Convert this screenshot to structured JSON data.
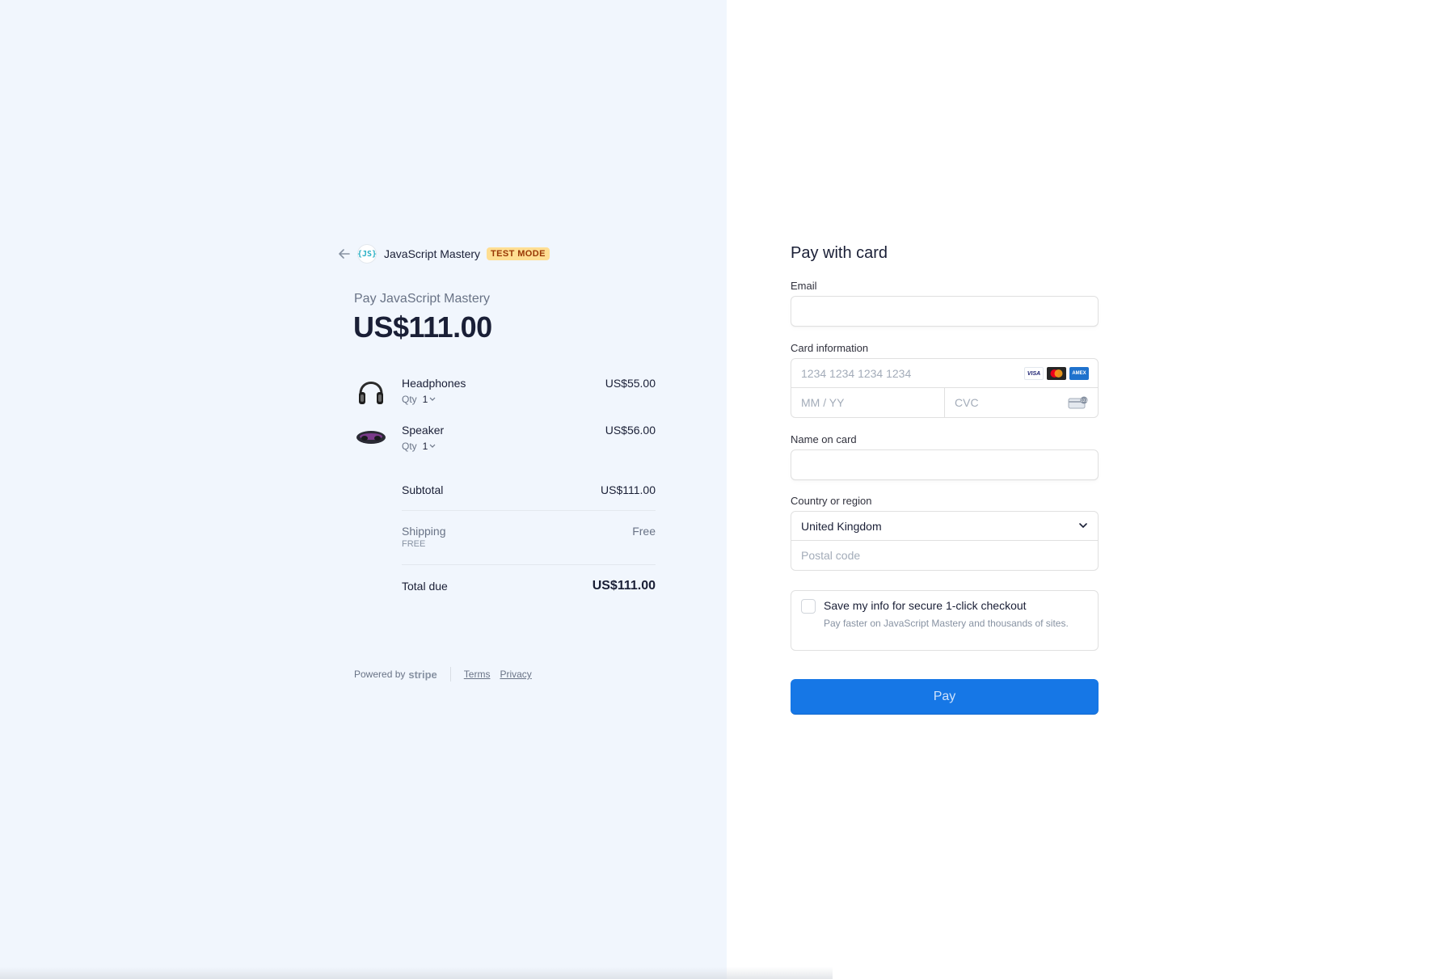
{
  "header": {
    "merchant_logo_text": "{JS}",
    "merchant_name": "JavaScript Mastery",
    "test_mode_label": "TEST MODE"
  },
  "summary": {
    "pay_label": "Pay JavaScript Mastery",
    "amount": "US$111.00"
  },
  "items": [
    {
      "name": "Headphones",
      "qty_label": "Qty",
      "qty": "1",
      "price": "US$55.00",
      "image_icon": "headphones-icon"
    },
    {
      "name": "Speaker",
      "qty_label": "Qty",
      "qty": "1",
      "price": "US$56.00",
      "image_icon": "speaker-icon"
    }
  ],
  "totals": {
    "subtotal_label": "Subtotal",
    "subtotal_value": "US$111.00",
    "shipping_label": "Shipping",
    "shipping_sub": "FREE",
    "shipping_value": "Free",
    "total_label": "Total due",
    "total_value": "US$111.00"
  },
  "footer": {
    "powered_by": "Powered by",
    "stripe": "stripe",
    "terms": "Terms",
    "privacy": "Privacy"
  },
  "form": {
    "title": "Pay with card",
    "email_label": "Email",
    "email_value": "",
    "card_label": "Card information",
    "card_number_placeholder": "1234 1234 1234 1234",
    "expiry_placeholder": "MM / YY",
    "cvc_placeholder": "CVC",
    "card_brands": {
      "visa": "VISA",
      "mastercard": "mastercard-icon",
      "amex": "AMEX"
    },
    "name_label": "Name on card",
    "name_value": "",
    "country_label": "Country or region",
    "country_value": "United Kingdom",
    "postal_placeholder": "Postal code",
    "save_title": "Save my info for secure 1-click checkout",
    "save_desc": "Pay faster on JavaScript Mastery and thousands of sites.",
    "pay_button": "Pay"
  },
  "colors": {
    "left_bg": "#f1f6fd",
    "pay_button": "#1677e6",
    "test_badge_bg": "#ffde92",
    "test_badge_text": "#983705"
  }
}
